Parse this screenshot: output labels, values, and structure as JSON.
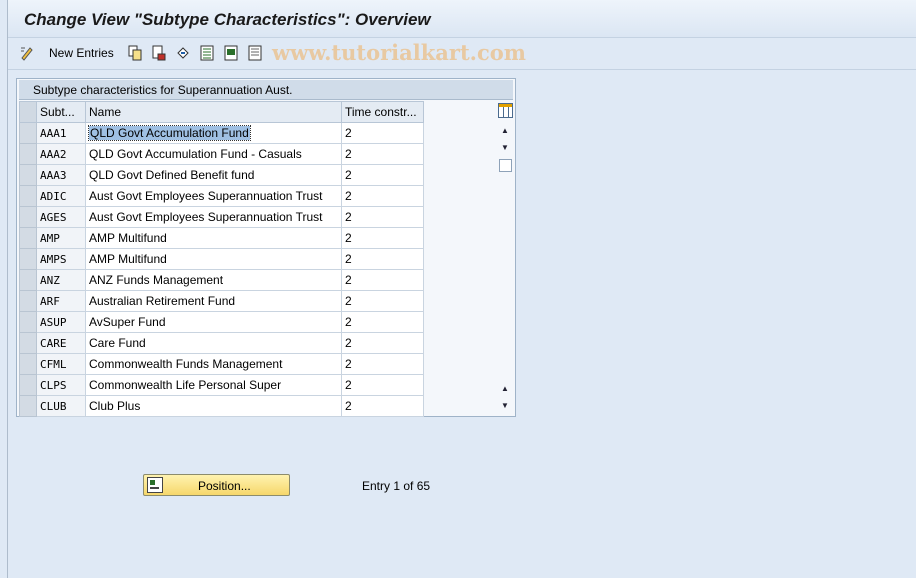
{
  "title": "Change View \"Subtype Characteristics\": Overview",
  "toolbar": {
    "new_entries_label": "New Entries",
    "watermark": "www.tutorialkart.com"
  },
  "panel": {
    "title": "Subtype characteristics for Superannuation Aust.",
    "columns": [
      "Subt...",
      "Name",
      "Time constr..."
    ]
  },
  "rows": [
    {
      "subtype": "AAA1",
      "name": "QLD Govt Accumulation Fund",
      "time": "2"
    },
    {
      "subtype": "AAA2",
      "name": "QLD Govt Accumulation Fund -  Casuals",
      "time": "2"
    },
    {
      "subtype": "AAA3",
      "name": "QLD Govt Defined Benefit fund",
      "time": "2"
    },
    {
      "subtype": "ADIC",
      "name": "Aust Govt Employees Superannuation Trust",
      "time": "2"
    },
    {
      "subtype": "AGES",
      "name": "Aust Govt Employees Superannuation Trust",
      "time": "2"
    },
    {
      "subtype": "AMP",
      "name": "AMP Multifund",
      "time": "2"
    },
    {
      "subtype": "AMPS",
      "name": "AMP Multifund",
      "time": "2"
    },
    {
      "subtype": "ANZ",
      "name": "ANZ Funds Management",
      "time": "2"
    },
    {
      "subtype": "ARF",
      "name": "Australian Retirement Fund",
      "time": "2"
    },
    {
      "subtype": "ASUP",
      "name": "AvSuper Fund",
      "time": "2"
    },
    {
      "subtype": "CARE",
      "name": "Care  Fund",
      "time": "2"
    },
    {
      "subtype": "CFML",
      "name": "Commonwealth Funds Management",
      "time": "2"
    },
    {
      "subtype": "CLPS",
      "name": "Commonwealth Life Personal Super",
      "time": "2"
    },
    {
      "subtype": "CLUB",
      "name": "Club Plus",
      "time": "2"
    }
  ],
  "position_button": "Position...",
  "entry_info": "Entry 1 of 65"
}
